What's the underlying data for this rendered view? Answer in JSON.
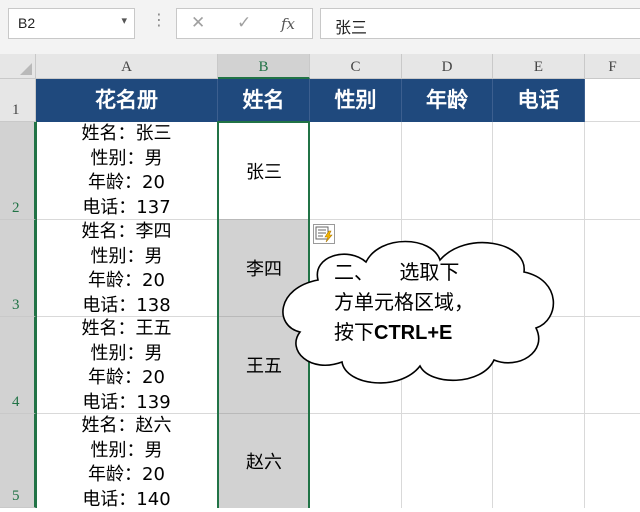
{
  "formula_bar": {
    "name_box": "B2",
    "cancel_symbol": "✕",
    "confirm_symbol": "✓",
    "fx_label": "fx",
    "formula_value": "张三"
  },
  "columns": [
    "A",
    "B",
    "C",
    "D",
    "E",
    "F"
  ],
  "rows": [
    "1",
    "2",
    "3",
    "4",
    "5"
  ],
  "header_row": {
    "a": "花名册",
    "b": "姓名",
    "c": "性别",
    "d": "年龄",
    "e": "电话"
  },
  "roster": [
    {
      "lines": [
        "姓名：张三",
        "性别：男",
        "年龄：20",
        "电话：137"
      ],
      "name": "张三"
    },
    {
      "lines": [
        "姓名：李四",
        "性别：男",
        "年龄：20",
        "电话：138"
      ],
      "name": "李四"
    },
    {
      "lines": [
        "姓名：王五",
        "性别：男",
        "年龄：20",
        "电话：139"
      ],
      "name": "王五"
    },
    {
      "lines": [
        "姓名：赵六",
        "性别：男",
        "年龄：20",
        "电话：140"
      ],
      "name": "赵六"
    }
  ],
  "callout": {
    "line1": "二、    选取下",
    "line2": "方单元格区域，",
    "line3_prefix": "按下",
    "line3_key": "CTRL+E"
  },
  "colors": {
    "header_fill": "#1f497d",
    "selection": "#217346",
    "selected_fill": "#d2d2d2"
  }
}
